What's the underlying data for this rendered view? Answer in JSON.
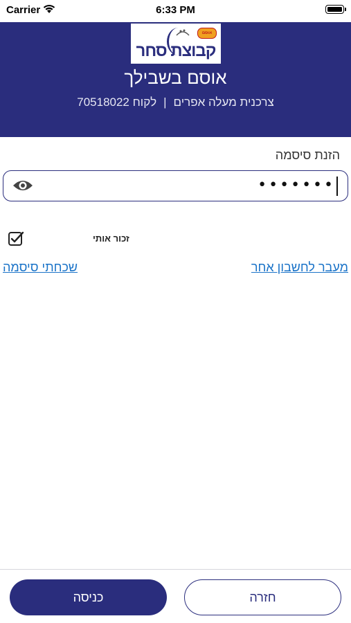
{
  "status_bar": {
    "carrier": "Carrier",
    "time": "6:33 PM"
  },
  "header": {
    "logo_text": "קבוצת סחר",
    "logo_brand_small": "Nestlé",
    "logo_brand_badge": "אוסם",
    "title": "אוסם בשבילך",
    "store_name": "צרכנית מעלה אפרים",
    "separator": "|",
    "customer": "לקוח 70518022",
    "background_color": "#2a2d7d"
  },
  "form": {
    "password_label": "הזנת סיסמה",
    "password_value": "•••••••",
    "show_password_icon": "eye-icon",
    "remember_label": "זכור אותי",
    "remember_checked": true,
    "link_switch_account": "מעבר לחשבון אחר",
    "link_forgot_password": "שכחתי סיסמה",
    "link_color": "#1a73c8"
  },
  "footer": {
    "enter_label": "כניסה",
    "back_label": "חזרה"
  }
}
